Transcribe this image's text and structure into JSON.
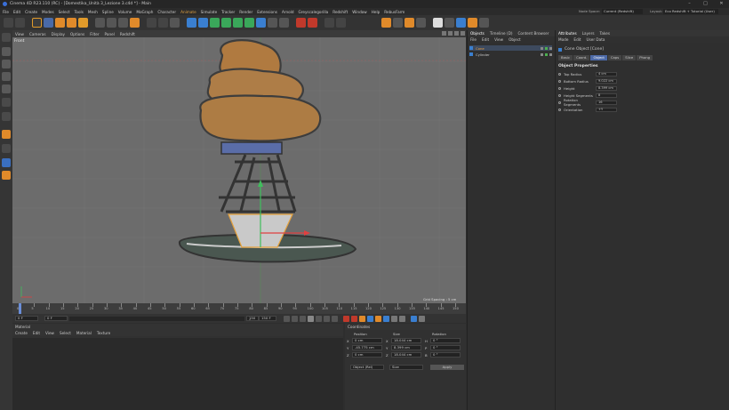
{
  "window": {
    "title": "Cinema 4D R23.110 (RC) - [Domestika_Unità 3_Lezione 3.c4d *] - Main"
  },
  "menu": [
    "File",
    "Edit",
    "Create",
    "Modes",
    "Select",
    "Tools",
    "Mesh",
    "Spline",
    "Volume",
    "MoGraph",
    "Character",
    "Animate",
    "Simulate",
    "Tracker",
    "Render",
    "Extensions",
    "Arnold",
    "Greyscalegorilla",
    "Redshift",
    "Window",
    "Help",
    "RebusFarm"
  ],
  "menu_highlight": "Animate",
  "node_space": {
    "label": "Node Space:",
    "value": "Current (Redshift)"
  },
  "layout": {
    "label": "Layout:",
    "value": "Eco Redshift + Tutorial (User)"
  },
  "viewport": {
    "menu": [
      "View",
      "Cameras",
      "Display",
      "Options",
      "Filter",
      "Panel",
      "Redshift"
    ],
    "name": "Front",
    "grid_spacing": "Grid Spacing : 5 cm"
  },
  "timeline": {
    "ticks": [
      "0",
      "5",
      "10",
      "15",
      "20",
      "25",
      "30",
      "35",
      "40",
      "45",
      "50",
      "55",
      "60",
      "65",
      "70",
      "75",
      "80",
      "85",
      "90",
      "95",
      "100",
      "105",
      "110",
      "115",
      "120",
      "125",
      "130",
      "135",
      "140",
      "145",
      "150"
    ],
    "current_frame": "0 F",
    "start": "0 F",
    "end_a": "150 F",
    "end_b": "150 F"
  },
  "material": {
    "title": "Material",
    "menu": [
      "Create",
      "Edit",
      "View",
      "Select",
      "Material",
      "Texture"
    ]
  },
  "coordinates": {
    "title": "Coordinates",
    "cols": [
      "Position",
      "Size",
      "Rotation"
    ],
    "rows": [
      {
        "axis": "X",
        "pos": "0 cm",
        "size_axis": "X",
        "size": "18.044 cm",
        "rot_axis": "H",
        "rot": "0 °"
      },
      {
        "axis": "Y",
        "pos": "-45.775 cm",
        "size_axis": "Y",
        "size": "8.399 cm",
        "rot_axis": "P",
        "rot": "0 °"
      },
      {
        "axis": "Z",
        "pos": "0 cm",
        "size_axis": "Z",
        "size": "18.044 cm",
        "rot_axis": "B",
        "rot": "0 °"
      }
    ],
    "mode_a": "Object (Rel)",
    "mode_b": "Size",
    "apply": "Apply"
  },
  "objects": {
    "tabs": [
      "Objects",
      "Timeline (D)",
      "Content Browser"
    ],
    "menu": [
      "File",
      "Edit",
      "View",
      "Object"
    ],
    "items": [
      "Cone",
      "Cylinder"
    ]
  },
  "attributes": {
    "tabs": [
      "Attributes",
      "Layers",
      "Takes"
    ],
    "menu": [
      "Mode",
      "Edit",
      "User Data"
    ],
    "object_title": "Cone Object [Cone]",
    "subtabs": [
      "Basic",
      "Coord.",
      "Object",
      "Caps",
      "Slice",
      "Phong"
    ],
    "active_subtab": "Object",
    "section": "Object Properties",
    "props": [
      {
        "label": "Top Radius",
        "value": "4 cm"
      },
      {
        "label": "Bottom Radius",
        "value": "9.022 cm"
      },
      {
        "label": "Height",
        "value": "8.399 cm"
      },
      {
        "label": "Height Segments",
        "value": "8"
      },
      {
        "label": "Rotation Segments",
        "value": "16"
      },
      {
        "label": "Orientation",
        "value": "+Y"
      }
    ]
  }
}
